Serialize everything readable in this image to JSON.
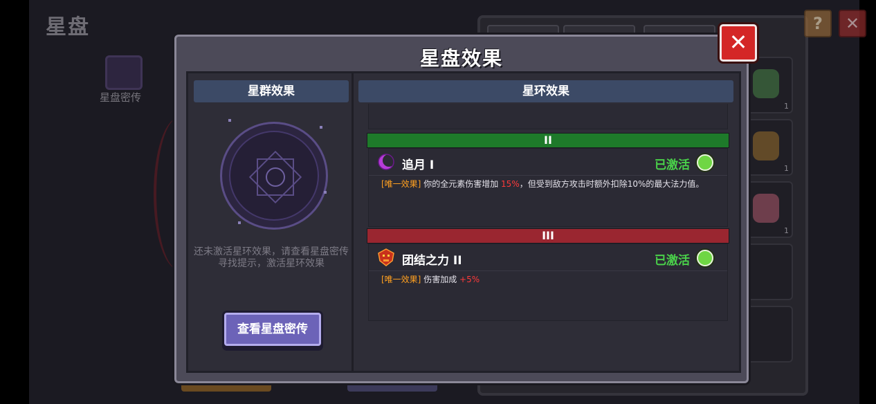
{
  "background": {
    "title": "星盘",
    "book_label": "星盘密传",
    "slot_counts": [
      "1",
      "1",
      "1"
    ]
  },
  "modal": {
    "title": "星盘效果",
    "close_symbol": "✕",
    "left": {
      "header": "星群效果",
      "hint": "还未激活星环效果，请查看星盘密传寻找提示，激活星环效果",
      "button": "查看星盘密传"
    },
    "right": {
      "header": "星环效果",
      "tiers": [
        {
          "label": "II",
          "color": "#1e7a2a",
          "effect": {
            "icon": "crescent-moon-icon",
            "name": "追月 I",
            "status": "已激活",
            "desc_tag": "[唯一效果]",
            "desc_pre": "你的全元素伤害增加",
            "desc_value": "15%",
            "desc_post": "，但受到敌方攻击时额外扣除10%的最大法力值。"
          }
        },
        {
          "label": "III",
          "color": "#9a2630",
          "effect": {
            "icon": "demon-mask-icon",
            "name": "团结之力 II",
            "status": "已激活",
            "desc_tag": "[唯一效果]",
            "desc_pre": "伤害加成",
            "desc_value": "+5%",
            "desc_post": ""
          }
        }
      ]
    }
  },
  "colors": {
    "active_green": "#4ad24a",
    "tag_orange": "#ffa020",
    "value_red": "#ff3a3a",
    "close_red": "#d42626"
  }
}
